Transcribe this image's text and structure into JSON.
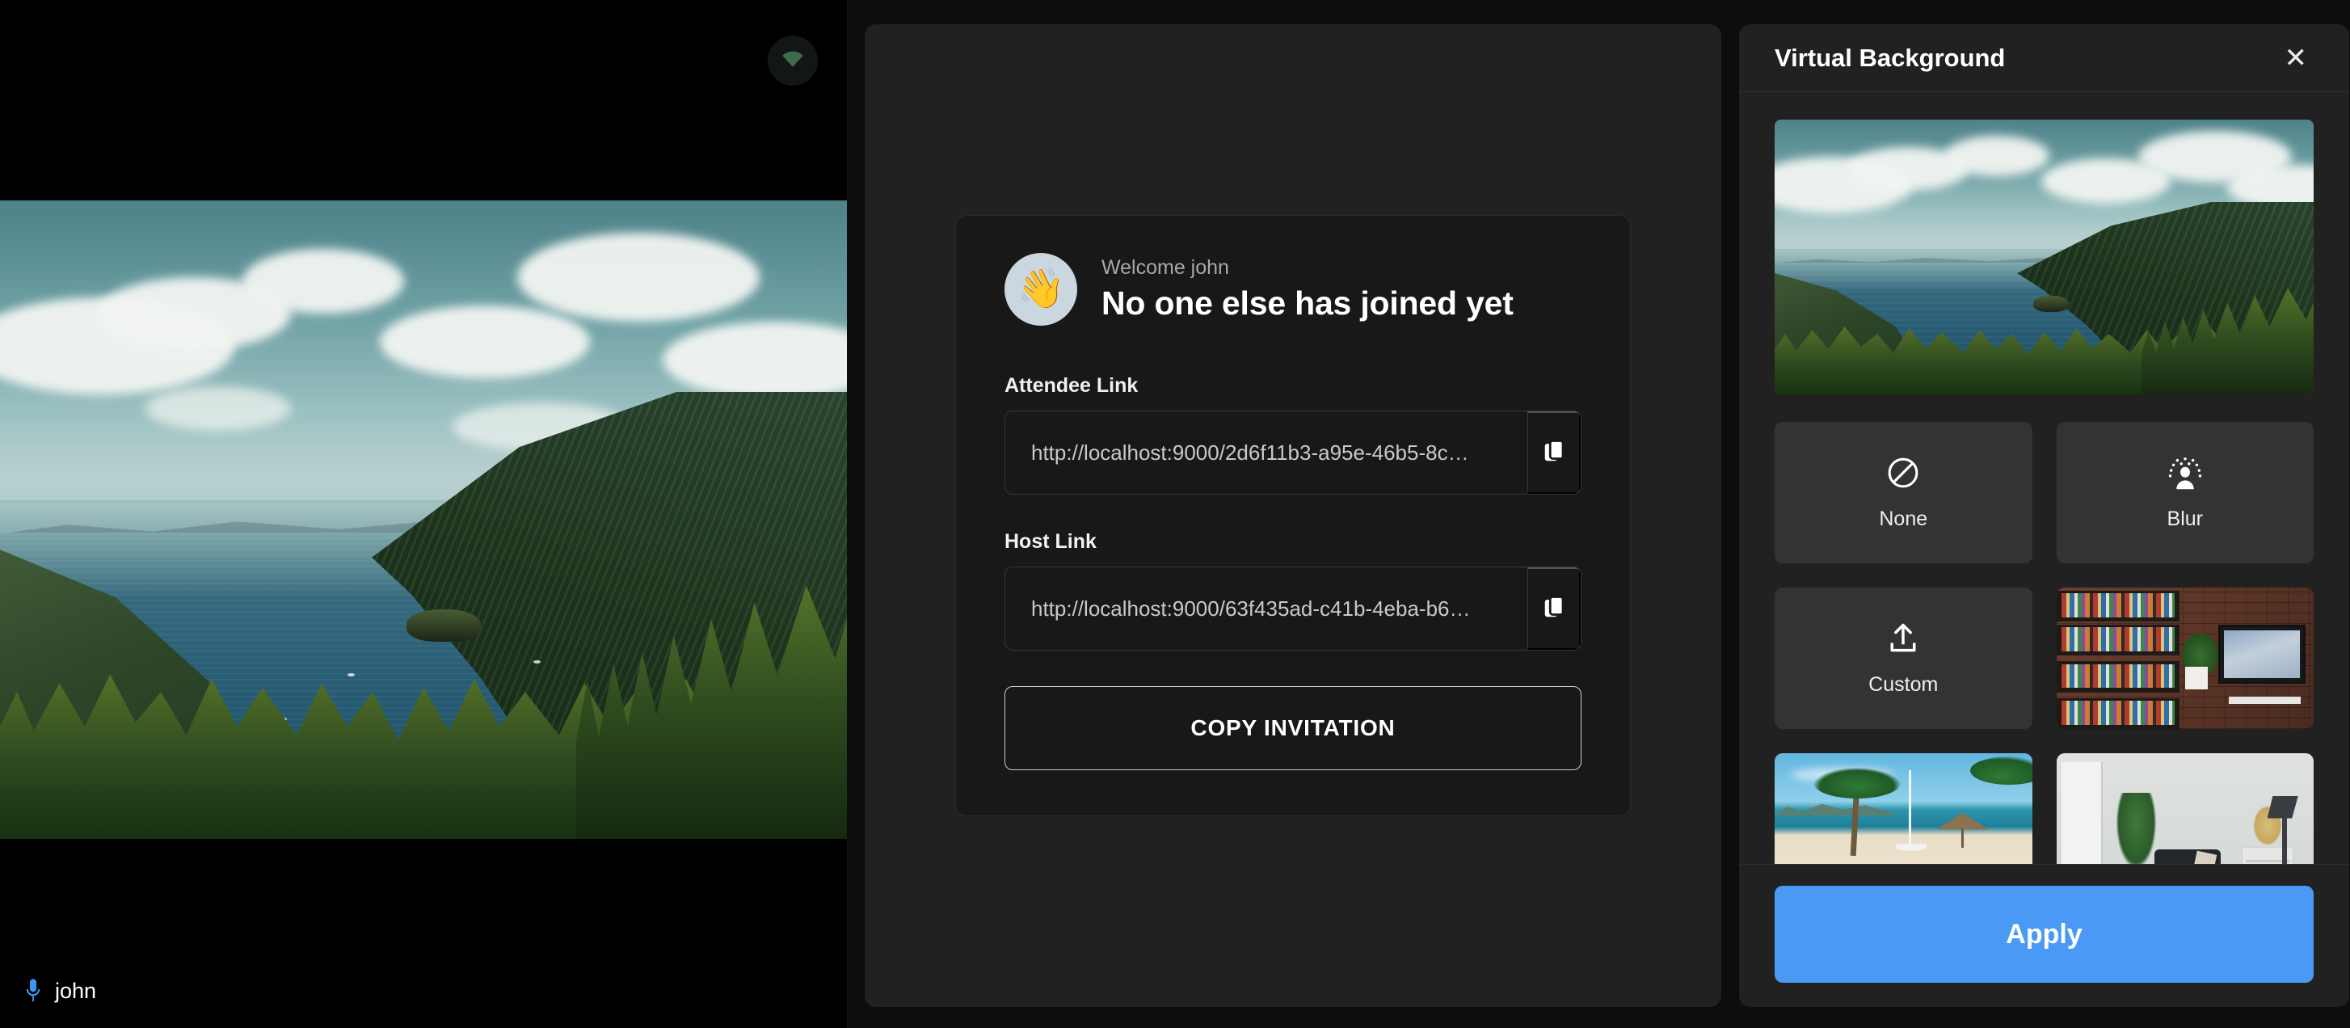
{
  "video_tile": {
    "participant_name": "john",
    "mic_icon": "microphone-icon",
    "mic_color": "#3b97f0",
    "connection_icon": "wifi-signal-icon",
    "connection_color": "#3f6b4a",
    "background_scene": "lake-emerald-bay"
  },
  "invite": {
    "wave_emoji": "👋",
    "welcome_small": "Welcome john",
    "welcome_big": "No one else has joined yet",
    "attendee_label": "Attendee Link",
    "attendee_value": "http://localhost:9000/2d6f11b3-a95e-46b5-8c…",
    "host_label": "Host Link",
    "host_value": "http://localhost:9000/63f435ad-c41b-4eba-b6…",
    "copy_icon": "copy-icon",
    "copy_invitation_label": "COPY INVITATION"
  },
  "virtual_background": {
    "title": "Virtual Background",
    "close_icon": "close-icon",
    "preview_label": "lake-emerald-bay",
    "options": [
      {
        "id": "none",
        "label": "None",
        "icon": "no-symbol-icon",
        "type": "icon"
      },
      {
        "id": "blur",
        "label": "Blur",
        "icon": "blur-person-icon",
        "type": "icon"
      },
      {
        "id": "custom",
        "label": "Custom",
        "icon": "upload-icon",
        "type": "icon"
      },
      {
        "id": "bookshelf",
        "label": "",
        "icon": "",
        "type": "image",
        "scene": "bookshelf"
      },
      {
        "id": "beach",
        "label": "",
        "icon": "",
        "type": "image",
        "scene": "beach"
      },
      {
        "id": "room",
        "label": "",
        "icon": "",
        "type": "image",
        "scene": "room"
      }
    ],
    "apply_label": "Apply",
    "apply_color": "#4a9af5"
  }
}
